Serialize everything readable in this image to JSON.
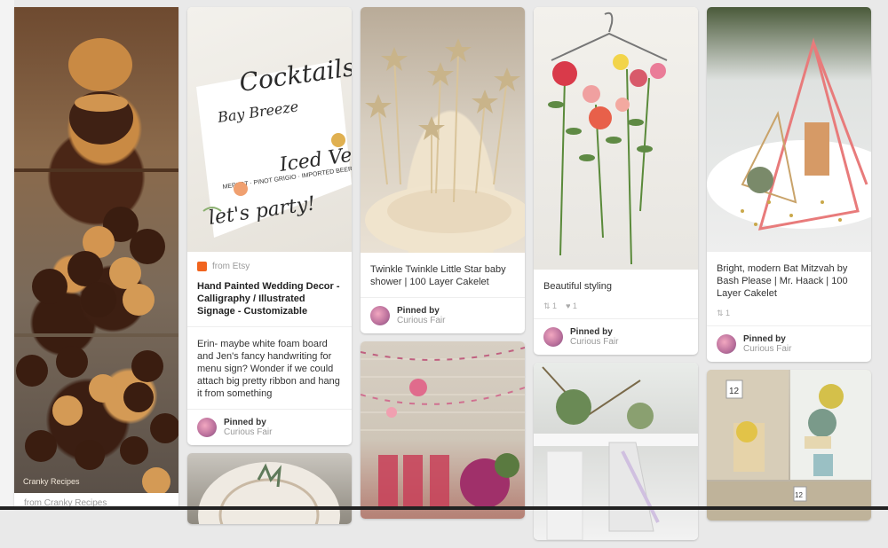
{
  "pins": {
    "p1": {
      "watermark": "Cranky Recipes",
      "source_text": "from Cranky Recipes"
    },
    "p2": {
      "source": "from Etsy",
      "description": "Hand Painted Wedding Decor - Calligraphy / Illustrated Signage - Customizable",
      "comment": "Erin- maybe white foam board and Jen's fancy handwriting for menu sign? Wonder if we could attach big pretty ribbon and hang it from something",
      "pinned_label": "Pinned by",
      "pinned_by": "Curious Fair",
      "art": {
        "l1": "Cocktails",
        "l2": "Bay Breeze",
        "l3": "Iced Velvet",
        "l4": "MERLOT · PINOT GRIGIO · IMPORTED BEERS",
        "l5": "let's party!"
      }
    },
    "p3": {
      "description": "Twinkle Twinkle Little Star baby shower | 100 Layer Cakelet",
      "pinned_label": "Pinned by",
      "pinned_by": "Curious Fair"
    },
    "p4": {
      "description": "Beautiful styling",
      "repins": "1",
      "likes": "1",
      "pinned_label": "Pinned by",
      "pinned_by": "Curious Fair"
    },
    "p5": {
      "description": "Bright, modern Bat Mitzvah by Bash Please | Mr. Haack | 100 Layer Cakelet",
      "repins": "1",
      "pinned_label": "Pinned by",
      "pinned_by": "Curious Fair"
    },
    "p6": {
      "table_number_1": "12",
      "table_number_2": "12"
    }
  },
  "colors": {
    "accent_etsy": "#f1641e",
    "card_bg": "#ffffff",
    "page_bg": "#e9e9e9"
  },
  "icons": {
    "repin": "pin-icon",
    "like": "heart-icon",
    "source": "etsy-icon"
  }
}
